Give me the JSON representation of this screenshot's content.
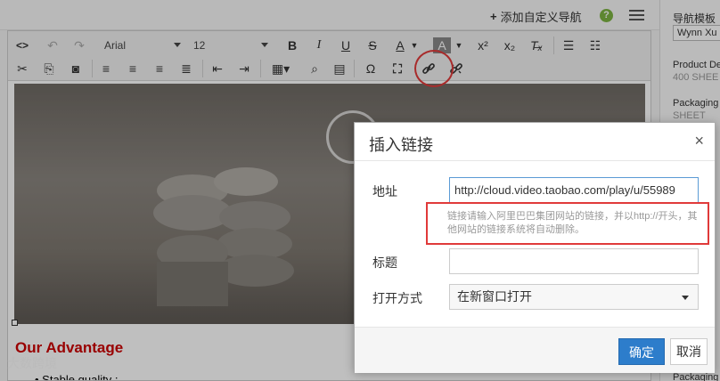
{
  "topbar": {
    "add_nav_label": "添加自定义导航",
    "add_nav_plus": "+",
    "help_icon_text": "?"
  },
  "right_panel": {
    "nav_template_label": "导航模板",
    "nav_template_value": "Wynn Xu",
    "product_label": "Product De",
    "product_value": "400 SHEE",
    "packaging_label": "Packaging",
    "packaging_value": "SHEET",
    "packaging2_label": "Packaging"
  },
  "toolbar": {
    "font_family": "Arial",
    "font_size": "12",
    "icons_row1": [
      "source-icon",
      "undo-icon",
      "redo-icon",
      "bold-icon",
      "italic-icon",
      "underline-icon",
      "strikethrough-icon",
      "font-color-icon",
      "background-color-icon",
      "superscript-icon",
      "subscript-icon",
      "clear-format-icon",
      "bullet-list-icon",
      "numbered-list-icon"
    ],
    "icons_row2": [
      "cut-icon",
      "copy-icon",
      "find-icon",
      "align-left-icon",
      "align-center-icon",
      "align-right-icon",
      "justify-icon",
      "outdent-icon",
      "indent-icon",
      "table-icon",
      "image-search-icon",
      "template-icon",
      "omega-icon",
      "fullscreen-icon",
      "link-icon",
      "unlink-icon"
    ]
  },
  "content": {
    "advantage_title": "Our Advantage",
    "bullet_1": "• Stable quality ;",
    "watermark": "大数跨境"
  },
  "dialog": {
    "title": "插入链接",
    "close_glyph": "×",
    "url_label": "地址",
    "url_value": "http://cloud.video.taobao.com/play/u/55989",
    "hint": "链接请输入阿里巴巴集团网站的链接，并以http://开头，其他网站的链接系统将自动删除。",
    "title_label": "标题",
    "title_value": "",
    "open_mode_label": "打开方式",
    "open_mode_value": "在新窗口打开",
    "ok_label": "确定",
    "cancel_label": "取消"
  },
  "colors": {
    "accent": "#2d7dcb",
    "highlight_red": "#e03a3a",
    "advantage_red": "#cc0000",
    "help_green": "#7cb342"
  }
}
